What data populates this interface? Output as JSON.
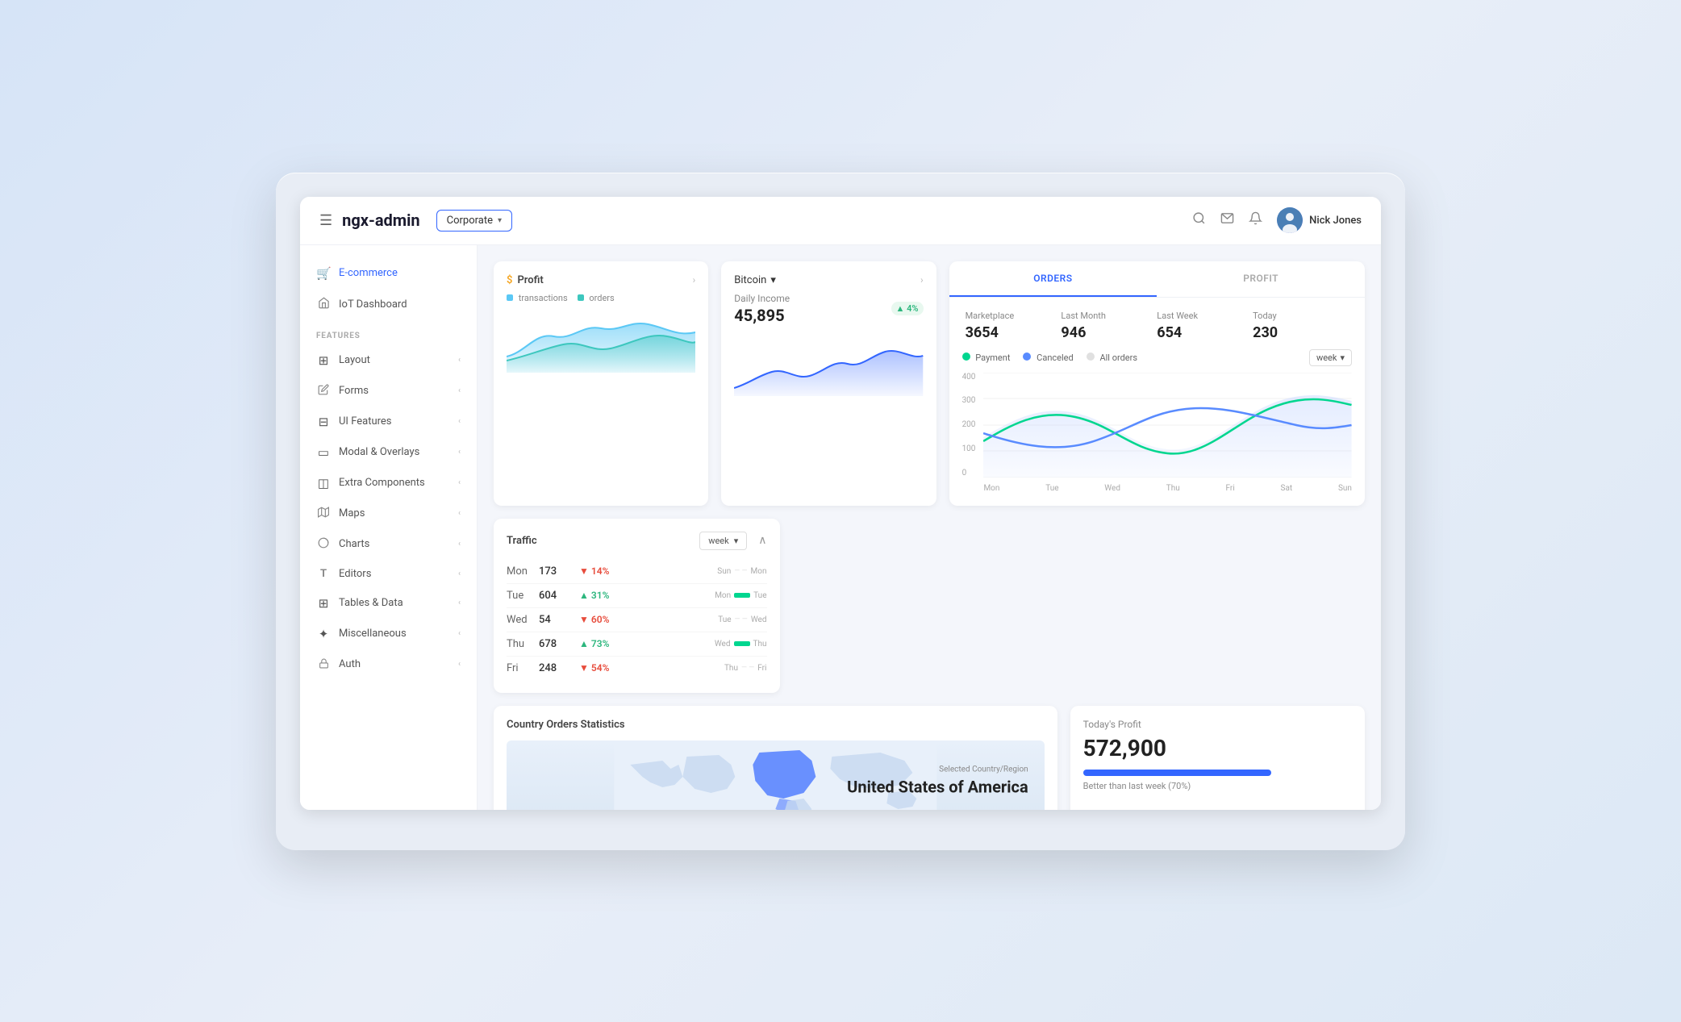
{
  "header": {
    "hamburger": "☰",
    "logo": "ngx-admin",
    "theme": "Corporate",
    "theme_chevron": "▾",
    "search_icon": "🔍",
    "mail_icon": "✉",
    "bell_icon": "🔔",
    "user_name": "Nick Jones"
  },
  "sidebar": {
    "nav_items": [
      {
        "id": "e-commerce",
        "icon": "🛒",
        "label": "E-commerce",
        "arrow": "",
        "active": true
      },
      {
        "id": "iot-dashboard",
        "icon": "🏠",
        "label": "IoT Dashboard",
        "arrow": ""
      }
    ],
    "features_label": "FEATURES",
    "feature_items": [
      {
        "id": "layout",
        "icon": "⊞",
        "label": "Layout",
        "arrow": "‹"
      },
      {
        "id": "forms",
        "icon": "✏",
        "label": "Forms",
        "arrow": "‹"
      },
      {
        "id": "ui-features",
        "icon": "⊟",
        "label": "UI Features",
        "arrow": "‹"
      },
      {
        "id": "modal-overlays",
        "icon": "▭",
        "label": "Modal & Overlays",
        "arrow": "‹"
      },
      {
        "id": "extra-components",
        "icon": "◫",
        "label": "Extra Components",
        "arrow": "‹"
      },
      {
        "id": "maps",
        "icon": "🗺",
        "label": "Maps",
        "arrow": "‹"
      },
      {
        "id": "charts",
        "icon": "◉",
        "label": "Charts",
        "arrow": "‹"
      },
      {
        "id": "editors",
        "icon": "T",
        "label": "Editors",
        "arrow": "‹"
      },
      {
        "id": "tables-data",
        "icon": "⊞",
        "label": "Tables & Data",
        "arrow": "‹"
      },
      {
        "id": "miscellaneous",
        "icon": "✦",
        "label": "Miscellaneous",
        "arrow": "‹"
      },
      {
        "id": "auth",
        "icon": "🔒",
        "label": "Auth",
        "arrow": "‹"
      }
    ]
  },
  "profit_card": {
    "title": "Profit",
    "legend_transactions": "transactions",
    "legend_orders": "orders"
  },
  "bitcoin_card": {
    "currency": "Bitcoin",
    "chevron": "▾",
    "daily_income_label": "Daily Income",
    "daily_income_value": "45,895",
    "badge": "▲ 4%"
  },
  "orders_card": {
    "tab_orders": "ORDERS",
    "tab_profit": "PROFIT",
    "stats": [
      {
        "label": "Marketplace",
        "value": "3654"
      },
      {
        "label": "Last Month",
        "value": "946"
      },
      {
        "label": "Last Week",
        "value": "654"
      },
      {
        "label": "Today",
        "value": "230"
      }
    ],
    "legend_payment": "Payment",
    "legend_canceled": "Canceled",
    "legend_all": "All orders",
    "filter_label": "week",
    "y_labels": [
      "400",
      "300",
      "200",
      "100",
      "0"
    ],
    "x_labels": [
      "Mon",
      "Tue",
      "Wed",
      "Thu",
      "Fri",
      "Sat",
      "Sun"
    ]
  },
  "traffic_card": {
    "title": "Traffic",
    "filter": "week",
    "rows": [
      {
        "day": "Mon",
        "value": "173",
        "pct": "▼ 14%",
        "dir": "down",
        "from": "Sun",
        "to": "Mon"
      },
      {
        "day": "Tue",
        "value": "604",
        "pct": "▲ 31%",
        "dir": "up",
        "from": "Mon",
        "to": "Tue"
      },
      {
        "day": "Wed",
        "value": "54",
        "pct": "▼ 60%",
        "dir": "down",
        "from": "Tue",
        "to": "Wed"
      },
      {
        "day": "Thu",
        "value": "678",
        "pct": "▲ 73%",
        "dir": "up",
        "from": "Wed",
        "to": "Thu"
      },
      {
        "day": "Fri",
        "value": "248",
        "pct": "▼ 54%",
        "dir": "down",
        "from": "Thu",
        "to": "Fri"
      }
    ]
  },
  "map_card": {
    "title": "Country Orders Statistics",
    "country_sublabel": "Selected Country/Region",
    "country_name": "United States of America"
  },
  "profit_today_card": {
    "label": "Today's Profit",
    "value": "572,900",
    "comparison": "Better than last week (70%)"
  },
  "colors": {
    "primary": "#3366ff",
    "teal": "#2cb67d",
    "red": "#e74c3c",
    "orange": "#f5a623",
    "light_blue": "#5bc8f5",
    "chart_teal": "#00d68f",
    "chart_blue": "#598bff"
  }
}
